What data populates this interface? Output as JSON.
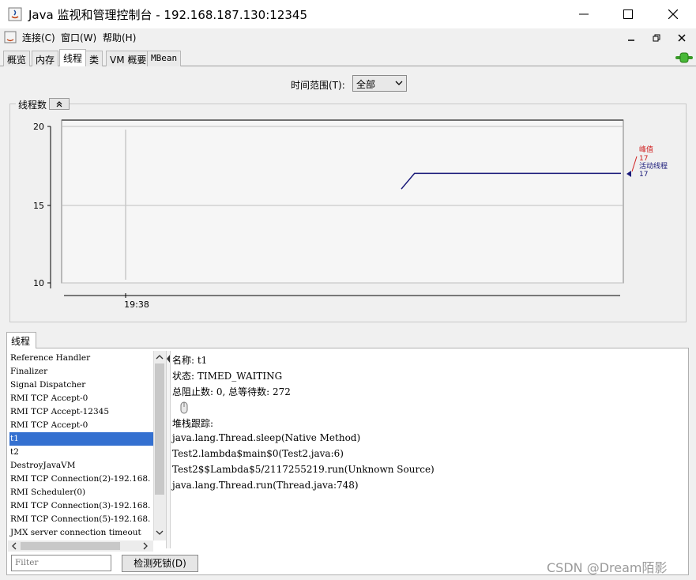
{
  "window": {
    "title": "Java 监视和管理控制台 - 192.168.187.130:12345"
  },
  "menu": {
    "connect": "连接(C)",
    "window": "窗口(W)",
    "help": "帮助(H)"
  },
  "tabs": {
    "overview": "概览",
    "memory": "内存",
    "threads": "线程",
    "classes": "类",
    "vm": "VM 概要",
    "mbean": "MBean"
  },
  "time_range": {
    "label": "时间范围(T):",
    "value": "全部"
  },
  "chart_title": "线程数",
  "chart_data": {
    "type": "line",
    "y_ticks": [
      "20",
      "15",
      "10"
    ],
    "x_ticks": [
      "19:38"
    ],
    "ylim": [
      10,
      20
    ],
    "series": [
      {
        "name": "峰值",
        "value": "17",
        "color": "#d02020"
      },
      {
        "name": "活动线程",
        "value": "17",
        "color": "#1a1a7a"
      }
    ],
    "active_line": {
      "x": [
        0,
        0.06,
        1
      ],
      "y": [
        16,
        17,
        17
      ]
    }
  },
  "threads_panel": {
    "tab_label": "线程",
    "items": [
      "Reference Handler",
      "Finalizer",
      "Signal Dispatcher",
      "RMI TCP Accept-0",
      "RMI TCP Accept-12345",
      "RMI TCP Accept-0",
      "t1",
      "t2",
      "DestroyJavaVM",
      "RMI TCP Connection(2)-192.168.",
      "RMI Scheduler(0)",
      "RMI TCP Connection(3)-192.168.",
      "RMI TCP Connection(5)-192.168.",
      "JMX server connection timeout"
    ],
    "selected": "t1",
    "filter_placeholder": "Filter",
    "deadlock_button": "检测死锁(D)"
  },
  "detail": {
    "name_line": "名称: t1",
    "state_line": "状态: TIMED_WAITING",
    "counts_line": "总阻止数: 0, 总等待数: 272",
    "stack_label": "堆栈跟踪:",
    "stack": [
      "java.lang.Thread.sleep(Native Method)",
      "Test2.lambda$main$0(Test2.java:6)",
      "Test2$$Lambda$5/2117255219.run(Unknown Source)",
      "java.lang.Thread.run(Thread.java:748)"
    ]
  },
  "watermark": "CSDN @Dream陌影"
}
